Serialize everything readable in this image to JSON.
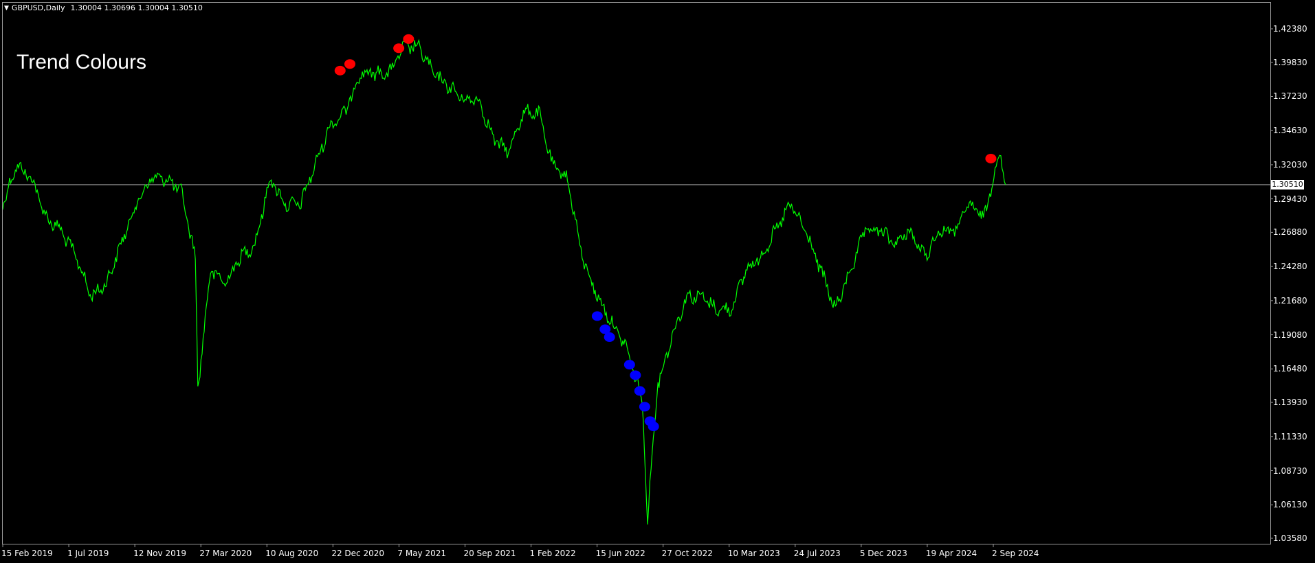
{
  "header": {
    "symbol": "GBPUSD,Daily",
    "ohlc": "1.30004 1.30696 1.30004 1.30510"
  },
  "overlay": {
    "title": "Trend Colours"
  },
  "current_price": {
    "label": "1.30510",
    "value": 1.3051
  },
  "colors": {
    "background": "#000000",
    "price_line": "#00ff00",
    "down_trend_marker": "#ff0000",
    "up_trend_marker": "#0000ff",
    "axis_text": "#ffffff",
    "current_price_line": "#c0c0c0"
  },
  "chart_data": {
    "type": "line",
    "title": "",
    "ylim": [
      1.03,
      1.435
    ],
    "xlim": [
      "2019-02-15",
      "2024-09-27"
    ],
    "y_ticks": [
      "1.42380",
      "1.39830",
      "1.37230",
      "1.34630",
      "1.32030",
      "1.29430",
      "1.26880",
      "1.24280",
      "1.21680",
      "1.19080",
      "1.16480",
      "1.13930",
      "1.11330",
      "1.08730",
      "1.06130",
      "1.03580"
    ],
    "x_ticks": [
      "15 Feb 2019",
      "1 Jul 2019",
      "12 Nov 2019",
      "27 Mar 2020",
      "10 Aug 2020",
      "22 Dec 2020",
      "7 May 2021",
      "20 Sep 2021",
      "1 Feb 2022",
      "15 Jun 2022",
      "27 Oct 2022",
      "10 Mar 2023",
      "24 Jul 2023",
      "5 Dec 2023",
      "19 Apr 2024",
      "2 Sep 2024"
    ],
    "series": [
      {
        "name": "GBPUSD",
        "x": [
          "2019-02-15",
          "2019-03-15",
          "2019-04-15",
          "2019-05-15",
          "2019-06-15",
          "2019-07-15",
          "2019-08-15",
          "2019-09-15",
          "2019-10-15",
          "2019-11-15",
          "2019-12-15",
          "2020-01-15",
          "2020-02-15",
          "2020-03-15",
          "2020-03-20",
          "2020-04-15",
          "2020-05-15",
          "2020-06-15",
          "2020-07-15",
          "2020-08-15",
          "2020-09-15",
          "2020-10-15",
          "2020-11-15",
          "2020-12-15",
          "2021-01-15",
          "2021-02-15",
          "2021-03-15",
          "2021-04-15",
          "2021-05-15",
          "2021-06-15",
          "2021-07-15",
          "2021-08-15",
          "2021-09-15",
          "2021-10-15",
          "2021-11-15",
          "2021-12-15",
          "2022-01-15",
          "2022-02-15",
          "2022-03-15",
          "2022-04-15",
          "2022-05-15",
          "2022-06-15",
          "2022-07-15",
          "2022-08-15",
          "2022-09-15",
          "2022-09-26",
          "2022-10-15",
          "2022-11-15",
          "2022-12-15",
          "2023-01-15",
          "2023-02-15",
          "2023-03-15",
          "2023-04-15",
          "2023-05-15",
          "2023-06-15",
          "2023-07-15",
          "2023-08-15",
          "2023-09-15",
          "2023-10-15",
          "2023-11-15",
          "2023-12-15",
          "2024-01-15",
          "2024-02-15",
          "2024-03-15",
          "2024-04-15",
          "2024-05-15",
          "2024-06-15",
          "2024-07-15",
          "2024-08-15",
          "2024-09-01",
          "2024-09-15",
          "2024-09-27"
        ],
        "y": [
          1.29,
          1.32,
          1.31,
          1.28,
          1.27,
          1.25,
          1.22,
          1.23,
          1.26,
          1.29,
          1.31,
          1.31,
          1.3,
          1.25,
          1.15,
          1.24,
          1.23,
          1.25,
          1.26,
          1.31,
          1.29,
          1.29,
          1.32,
          1.35,
          1.36,
          1.39,
          1.39,
          1.39,
          1.41,
          1.41,
          1.39,
          1.38,
          1.37,
          1.37,
          1.34,
          1.33,
          1.36,
          1.36,
          1.32,
          1.31,
          1.25,
          1.22,
          1.2,
          1.18,
          1.14,
          1.05,
          1.15,
          1.19,
          1.22,
          1.22,
          1.21,
          1.21,
          1.24,
          1.25,
          1.27,
          1.29,
          1.27,
          1.24,
          1.21,
          1.24,
          1.27,
          1.27,
          1.26,
          1.27,
          1.25,
          1.27,
          1.27,
          1.29,
          1.28,
          1.31,
          1.33,
          1.3051
        ]
      }
    ],
    "markers": [
      {
        "name": "down",
        "color": "#ff0000",
        "x": "2021-01-05",
        "y": 1.392
      },
      {
        "name": "down",
        "color": "#ff0000",
        "x": "2021-01-25",
        "y": 1.397
      },
      {
        "name": "down",
        "color": "#ff0000",
        "x": "2021-05-05",
        "y": 1.409
      },
      {
        "name": "down",
        "color": "#ff0000",
        "x": "2021-05-25",
        "y": 1.416
      },
      {
        "name": "down",
        "color": "#ff0000",
        "x": "2024-08-28",
        "y": 1.325
      },
      {
        "name": "up",
        "color": "#0000ff",
        "x": "2022-06-15",
        "y": 1.205
      },
      {
        "name": "up",
        "color": "#0000ff",
        "x": "2022-07-01",
        "y": 1.195
      },
      {
        "name": "up",
        "color": "#0000ff",
        "x": "2022-07-10",
        "y": 1.189
      },
      {
        "name": "up",
        "color": "#0000ff",
        "x": "2022-08-20",
        "y": 1.168
      },
      {
        "name": "up",
        "color": "#0000ff",
        "x": "2022-09-01",
        "y": 1.16
      },
      {
        "name": "up",
        "color": "#0000ff",
        "x": "2022-09-10",
        "y": 1.148
      },
      {
        "name": "up",
        "color": "#0000ff",
        "x": "2022-09-20",
        "y": 1.136
      },
      {
        "name": "up",
        "color": "#0000ff",
        "x": "2022-10-01",
        "y": 1.125
      },
      {
        "name": "up",
        "color": "#0000ff",
        "x": "2022-10-08",
        "y": 1.121
      }
    ],
    "legend": "none",
    "grid": false
  }
}
